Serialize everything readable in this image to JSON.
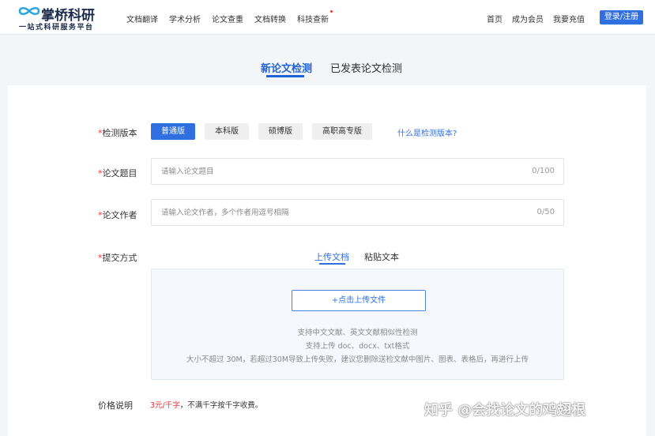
{
  "brand": {
    "name": "掌桥科研",
    "slogan": "一站式科研服务平台",
    "accent_color": "#2f6fe0"
  },
  "nav": {
    "items": [
      {
        "label": "文档翻译"
      },
      {
        "label": "学术分析"
      },
      {
        "label": "论文查重"
      },
      {
        "label": "文档转换"
      },
      {
        "label": "科技查新"
      }
    ],
    "right": {
      "home": "首页",
      "member": "成为会员",
      "recharge": "我要充值",
      "login": "登录/注册"
    }
  },
  "mode_tabs": {
    "new": "新论文检测",
    "published": "已发表论文检测"
  },
  "form": {
    "version": {
      "label": "检测版本",
      "options": [
        "普通版",
        "本科版",
        "硕博版",
        "高职高专版"
      ],
      "selected": "普通版",
      "help": "什么是检测版本?"
    },
    "title": {
      "label": "论文题目",
      "placeholder": "请输入论文题目",
      "value": "",
      "count": "0/100"
    },
    "author": {
      "label": "论文作者",
      "placeholder": "请输入论文作者，多个作者用逗号相隔",
      "value": "",
      "count": "0/50"
    },
    "submit": {
      "label": "提交方式",
      "tabs": [
        "上传文档",
        "粘贴文本"
      ],
      "upload_button": "+点击上传文件",
      "hints": [
        "支持中文文献、英文文献相似性检测",
        "支持上传 doc、docx、txt格式",
        "大小不超过 30M，若超过30M导致上传失败，建议您删除送检文献中图片、图表、表格后，再进行上传"
      ]
    },
    "price": {
      "label": "价格说明",
      "amount": "3元/千字",
      "note": "，不满千字按千字收费。"
    }
  },
  "watermark": "知乎 @会找论文的鸡翅根"
}
